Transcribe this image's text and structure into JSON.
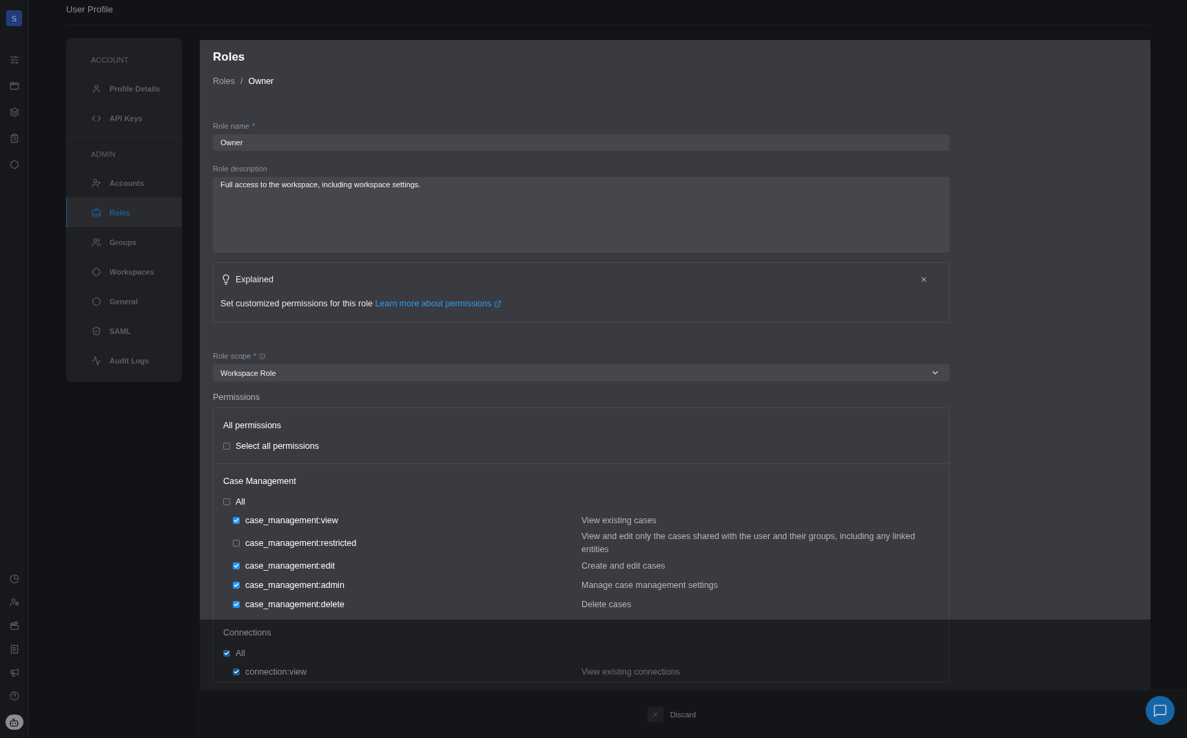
{
  "rail": {
    "avatar": "S"
  },
  "header": {
    "title": "User Profile"
  },
  "sidebar": {
    "sections": [
      {
        "heading": "ACCOUNT",
        "items": [
          {
            "label": "Profile Details",
            "selected": false
          },
          {
            "label": "API Keys",
            "selected": false
          }
        ]
      },
      {
        "heading": "ADMIN",
        "items": [
          {
            "label": "Accounts",
            "selected": false
          },
          {
            "label": "Roles",
            "selected": true
          },
          {
            "label": "Groups",
            "selected": false
          },
          {
            "label": "Workspaces",
            "selected": false
          },
          {
            "label": "General",
            "selected": false
          },
          {
            "label": "SAML",
            "selected": false
          },
          {
            "label": "Audit Logs",
            "selected": false
          }
        ]
      }
    ]
  },
  "page": {
    "title": "Roles",
    "breadcrumb": [
      "Roles",
      "/",
      "Owner"
    ]
  },
  "form": {
    "role_name": {
      "label": "Role name",
      "mark": "*",
      "value": "Owner"
    },
    "role_description": {
      "label": "Role description",
      "value": "Full access to the workspace, including workspace settings."
    },
    "explained": {
      "title": "Explained",
      "text": "Set customized permissions for this role",
      "link": "Learn more about permissions"
    },
    "role_scope": {
      "label": "Role scope",
      "mark": "*",
      "value": "Workspace Role"
    }
  },
  "permissions": {
    "label": "Permissions",
    "all": {
      "heading": "All permissions",
      "label": "Select all permissions",
      "checked": false
    },
    "groups": [
      {
        "name": "Case Management",
        "all": {
          "label": "All",
          "checked": false
        },
        "items": [
          {
            "name": "case_management:view",
            "description": "View existing cases",
            "checked": true
          },
          {
            "name": "case_management:restricted",
            "description": "View and edit only the cases shared with the user and their groups, including any linked entities",
            "checked": false
          },
          {
            "name": "case_management:edit",
            "description": "Create and edit cases",
            "checked": true
          },
          {
            "name": "case_management:admin",
            "description": "Manage case management settings",
            "checked": true
          },
          {
            "name": "case_management:delete",
            "description": "Delete cases",
            "checked": true
          }
        ]
      },
      {
        "name": "Connections",
        "all": {
          "label": "All",
          "checked": true
        },
        "items": [
          {
            "name": "connection:view",
            "description": "View existing connections",
            "checked": true
          }
        ]
      }
    ]
  },
  "footer": {
    "discard": "Discard"
  }
}
